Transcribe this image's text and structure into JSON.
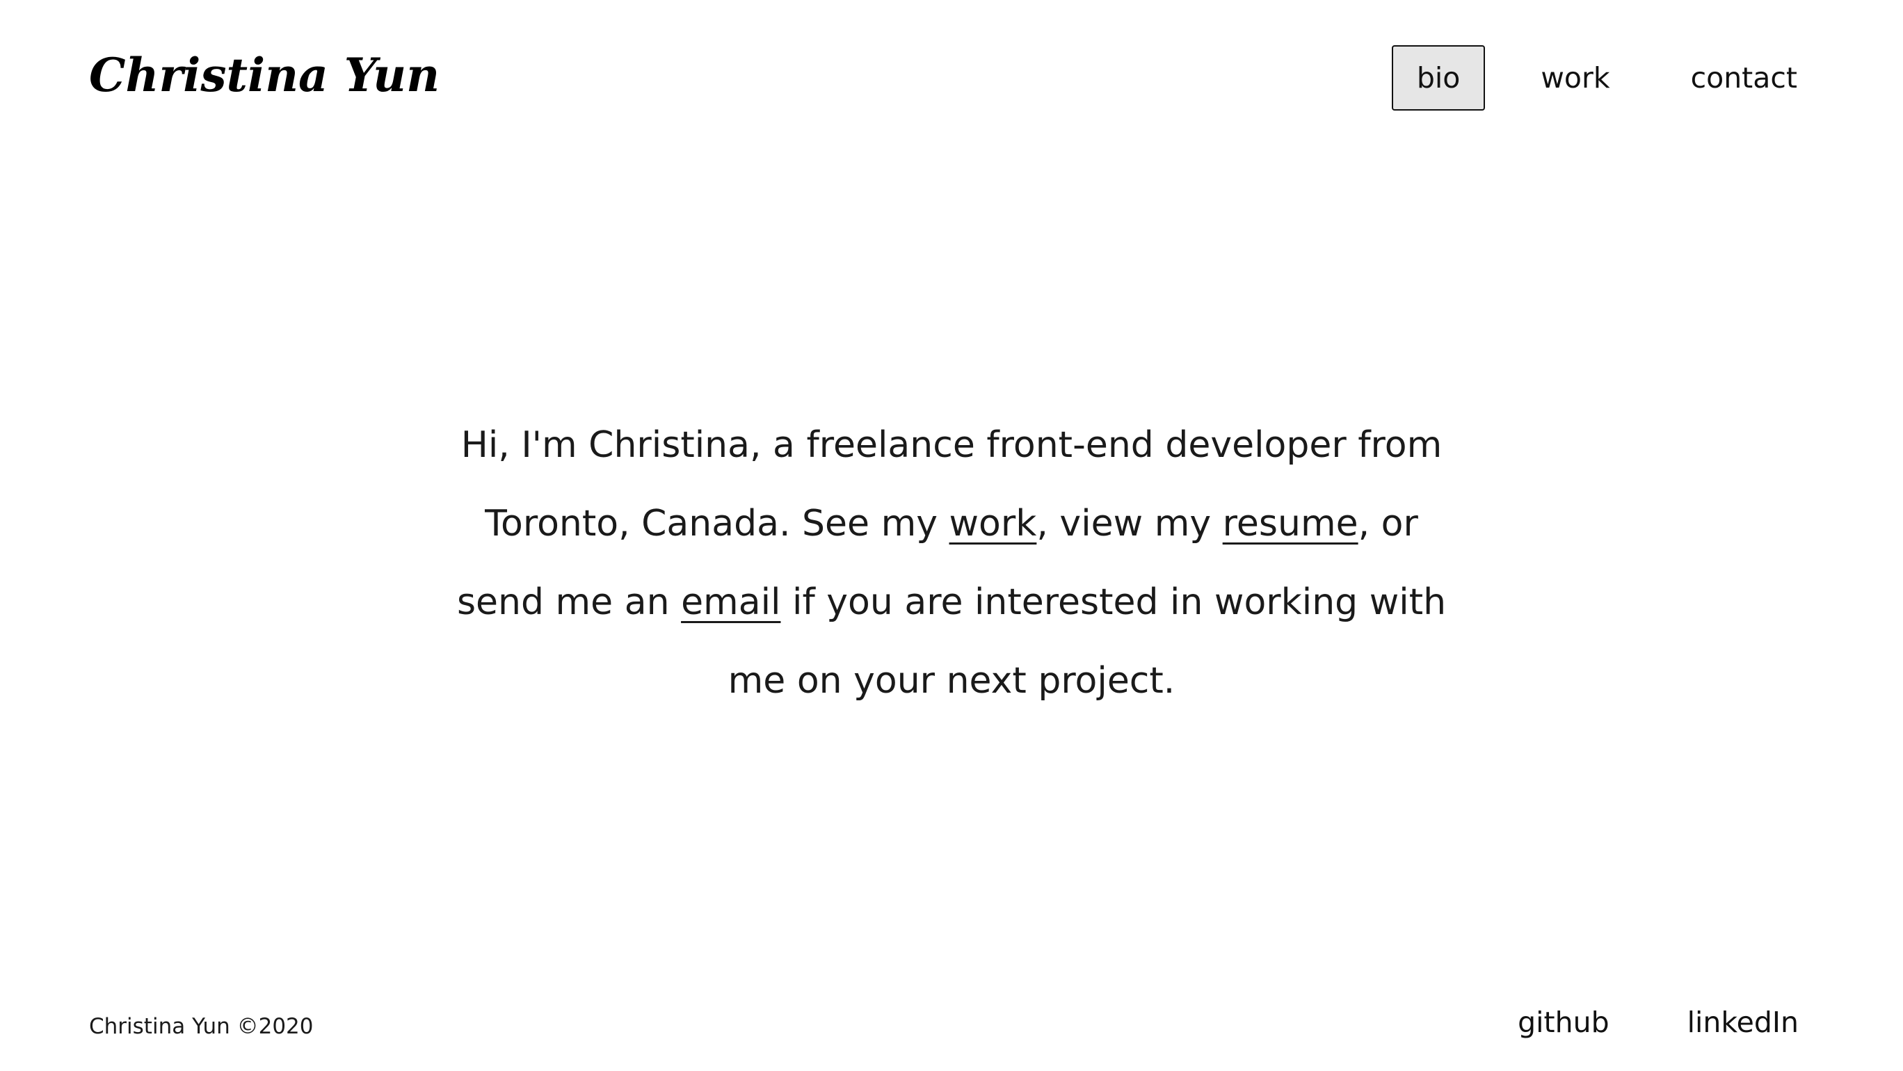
{
  "header": {
    "logo_text": "Christina Yun",
    "nav": {
      "bio": "bio",
      "work": "work",
      "contact": "contact",
      "active": "bio"
    }
  },
  "intro": {
    "part1": "Hi, I'm Christina, a freelance front-end developer from Toronto, Canada. See my ",
    "work_link": "work",
    "part2": ", view my ",
    "resume_link": "resume",
    "part3": ", or send me an ",
    "email_link": "email",
    "part4": " if you are interested in working with me on your next project."
  },
  "footer": {
    "copyright": "Christina Yun ©2020",
    "github": "github",
    "linkedin": "linkedIn"
  }
}
